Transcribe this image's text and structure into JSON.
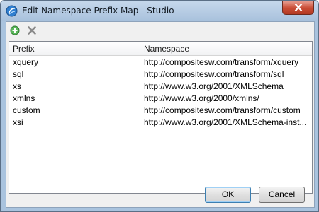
{
  "window": {
    "title": "Edit Namespace Prefix Map - Studio",
    "accent": "#a9c3de",
    "close_icon": "close-icon"
  },
  "toolbar": {
    "add_icon": "add-circle-icon",
    "delete_icon": "delete-x-icon"
  },
  "table": {
    "columns": [
      "Prefix",
      "Namespace"
    ],
    "rows": [
      {
        "prefix": "xquery",
        "namespace": "http://compositesw.com/transform/xquery"
      },
      {
        "prefix": "sql",
        "namespace": "http://compositesw.com/transform/sql"
      },
      {
        "prefix": "xs",
        "namespace": "http://www.w3.org/2001/XMLSchema"
      },
      {
        "prefix": "xmlns",
        "namespace": "http://www.w3.org/2000/xmlns/"
      },
      {
        "prefix": "custom",
        "namespace": "http://compositesw.com/transform/custom"
      },
      {
        "prefix": "xsi",
        "namespace": "http://www.w3.org/2001/XMLSchema-inst..."
      }
    ]
  },
  "buttons": {
    "ok": "OK",
    "cancel": "Cancel"
  }
}
